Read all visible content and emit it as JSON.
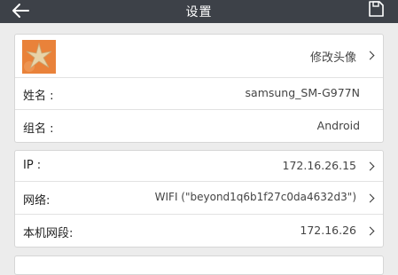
{
  "header": {
    "title": "设置",
    "back_icon": "arrow-left-icon",
    "save_icon": "save-icon"
  },
  "profile": {
    "avatar_icon": "starfish-avatar",
    "change_avatar_label": "修改头像",
    "name_label": "姓名 :",
    "name_value": "samsung_SM-G977N",
    "group_label": "组名 :",
    "group_value": "Android"
  },
  "network": {
    "ip_label": "IP :",
    "ip_value": "172.16.26.15",
    "network_label": "网络:",
    "network_value": "WIFI (\"beyond1q6b1f27c0da4632d3\")",
    "segment_label": "本机网段:",
    "segment_value": "172.16.26"
  },
  "colors": {
    "topbar": "#3d4148",
    "background": "#ececec",
    "avatar": "#e9823a"
  }
}
